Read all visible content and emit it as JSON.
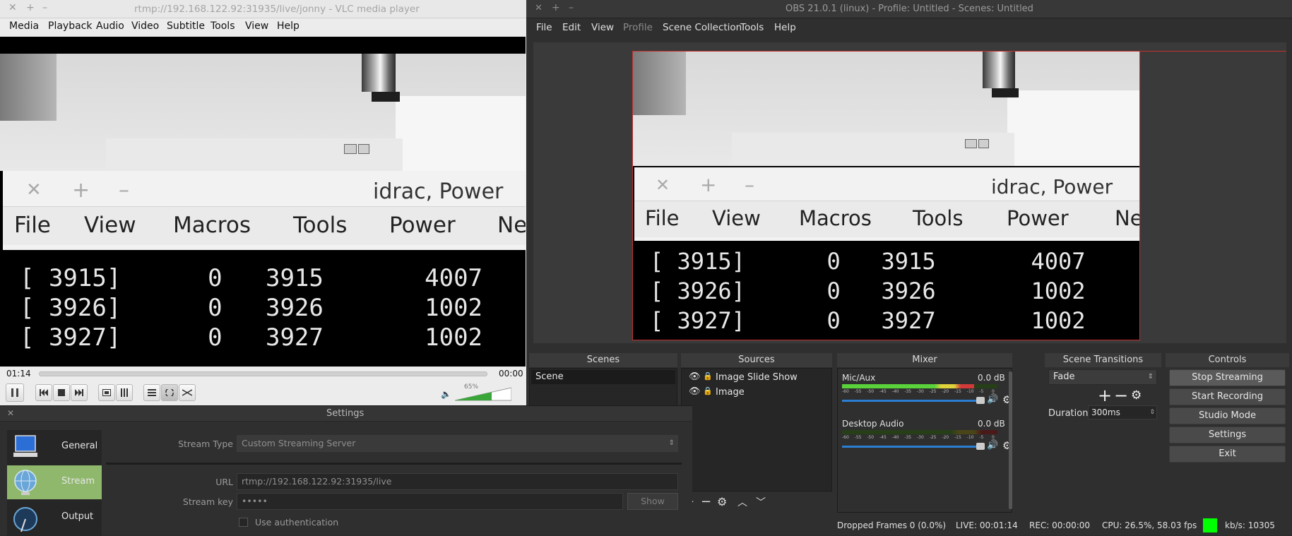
{
  "vlc": {
    "title": "rtmp://192.168.122.92:31935/live/jonny - VLC media player",
    "menu": [
      "Media",
      "Playback",
      "Audio",
      "Video",
      "Subtitle",
      "Tools",
      "View",
      "Help"
    ],
    "time_elapsed": "01:14",
    "time_total": "00:00",
    "volume": "65%",
    "volume_level": 0.65
  },
  "stream_content": {
    "window_title": "idrac, Power",
    "menu": [
      "File",
      "View",
      "Macros",
      "Tools",
      "Power",
      "Ne"
    ],
    "rows": [
      "[ 3915]      0   3915       4007",
      "[ 3926]      0   3926       1002",
      "[ 3927]      0   3927       1002"
    ]
  },
  "obs": {
    "title": "OBS 21.0.1 (linux) - Profile: Untitled - Scenes: Untitled",
    "menu": [
      "File",
      "Edit",
      "View",
      "Profile",
      "Scene Collection",
      "Tools",
      "Help"
    ],
    "docks": {
      "scenes": "Scenes",
      "sources": "Sources",
      "mixer": "Mixer",
      "transitions": "Scene Transitions",
      "controls": "Controls"
    },
    "scenes": [
      "Scene"
    ],
    "sources": [
      "Image Slide Show",
      "Image"
    ],
    "mixer": [
      {
        "name": "Mic/Aux",
        "db": "0.0 dB",
        "level": 0.85
      },
      {
        "name": "Desktop Audio",
        "db": "0.0 dB",
        "level": 0.0
      }
    ],
    "meter_ticks": [
      "-60",
      "-55",
      "-50",
      "-45",
      "-40",
      "-35",
      "-30",
      "-25",
      "-20",
      "-15",
      "-10",
      "-5",
      "0"
    ],
    "transition": {
      "value": "Fade",
      "duration_label": "Duration",
      "duration": "300ms"
    },
    "controls": [
      "Stop Streaming",
      "Start Recording",
      "Studio Mode",
      "Settings",
      "Exit"
    ],
    "status": {
      "dropped": "Dropped Frames 0 (0.0%)",
      "live": "LIVE: 00:01:14",
      "rec": "REC: 00:00:00",
      "cpu": "CPU: 26.5%, 58.03 fps",
      "kbs": "kb/s: 10305",
      "indicator_color": "#00ff00"
    }
  },
  "settings": {
    "title": "Settings",
    "nav": [
      "General",
      "Stream",
      "Output"
    ],
    "selected": "Stream",
    "stream_type_label": "Stream Type",
    "stream_type": "Custom Streaming Server",
    "url_label": "URL",
    "url": "rtmp://192.168.122.92:31935/live",
    "key_label": "Stream key",
    "key": "•••••",
    "show_label": "Show",
    "auth_label": "Use authentication"
  }
}
